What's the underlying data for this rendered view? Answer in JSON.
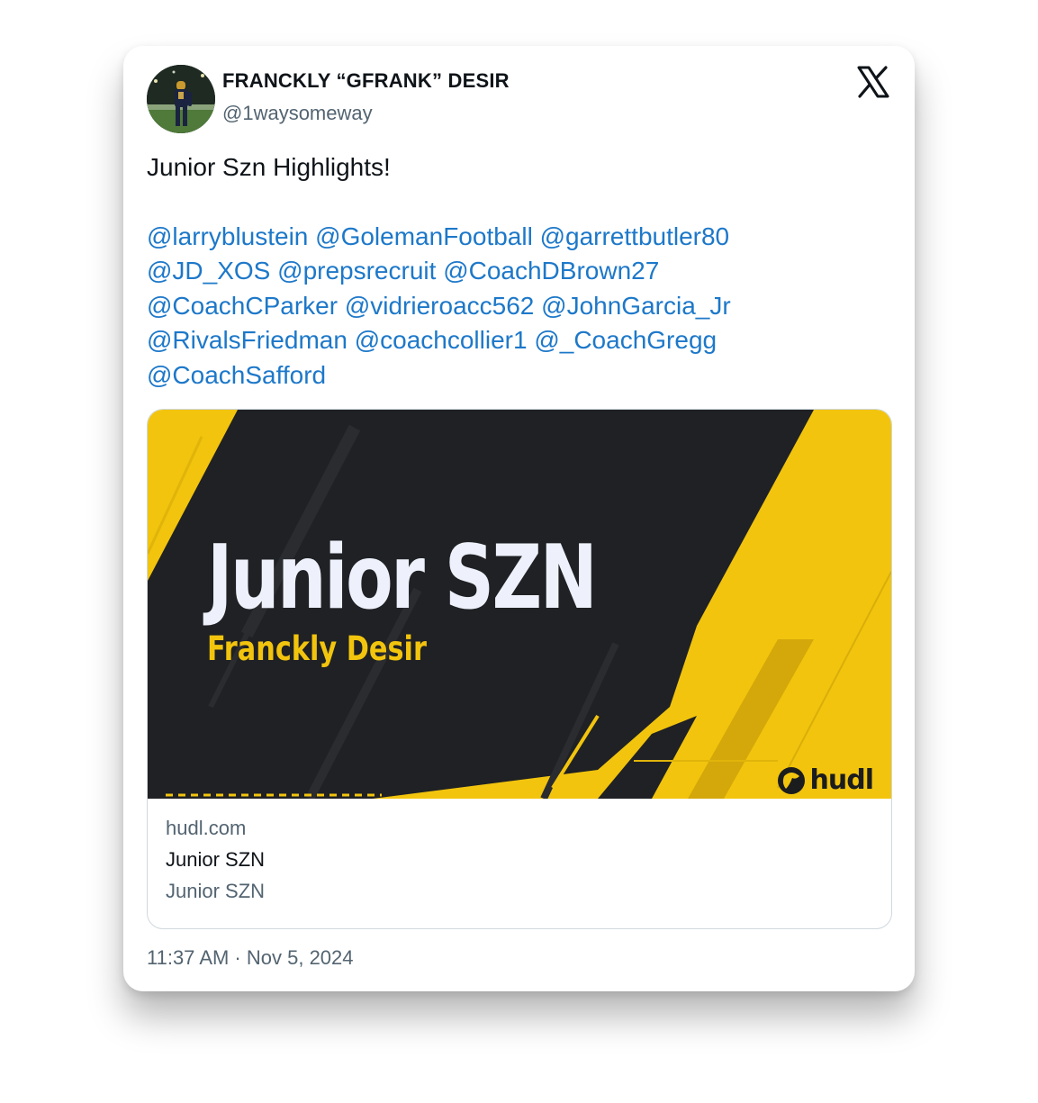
{
  "author": {
    "display_name": "FRANCKLY “GFRANK” DESIR",
    "handle": "@1waysomeway",
    "avatar_icon": "profile-photo"
  },
  "platform_icon": "x-logo-icon",
  "tweet": {
    "text": "Junior Szn Highlights!",
    "mentions": [
      "@larryblustein",
      "@GolemanFootball",
      "@garrettbutler80",
      "@JD_XOS",
      "@prepsrecruit",
      "@CoachDBrown27",
      "@CoachCParker",
      "@vidrieroacc562",
      "@JohnGarcia_Jr",
      "@RivalsFriedman",
      "@coachcollier1",
      "@_CoachGregg",
      "@CoachSafford"
    ]
  },
  "link_card": {
    "image": {
      "title": "Junior SZN",
      "subtitle": "Franckly Desir",
      "brand": "hudl"
    },
    "domain": "hudl.com",
    "title": "Junior SZN",
    "description": "Junior SZN"
  },
  "timestamp": "11:37 AM · Nov 5, 2024",
  "colors": {
    "mention": "#1d78c9",
    "banner_yellow": "#f2c40d",
    "banner_dark": "#1f2124",
    "text_primary": "#0f1419",
    "text_secondary": "#536471"
  }
}
